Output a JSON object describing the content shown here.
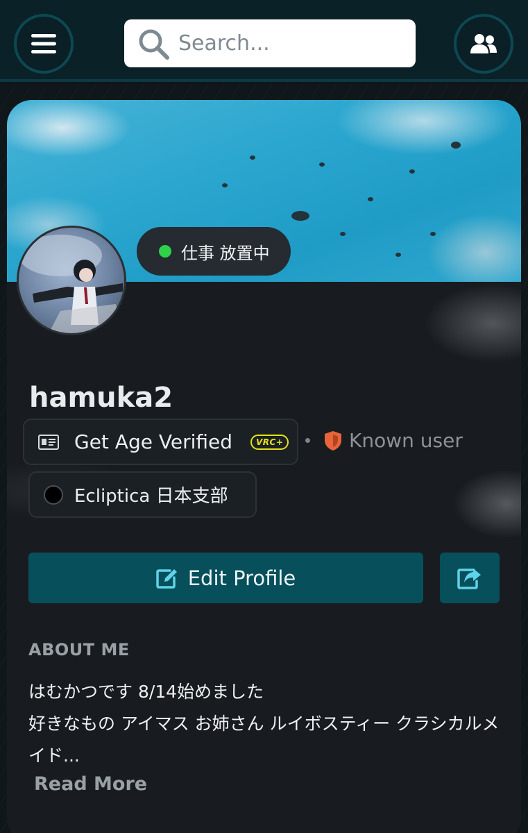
{
  "header": {
    "search_placeholder": "Search...",
    "menu_icon": "hamburger-icon",
    "friends_icon": "users-icon"
  },
  "profile": {
    "status_text": "仕事 放置中",
    "status_color": "#2ed34a",
    "username": "hamuka2",
    "age_verify_label": "Get Age Verified",
    "vrc_badge": "VRC+",
    "trust_label": "Known user",
    "group_name": "Ecliptica 日本支部",
    "edit_label": "Edit Profile"
  },
  "about": {
    "heading": "ABOUT ME",
    "text": "はむかつです 8/14始めました\n好きなもの アイマス お姉さん ルイボスティー クラシカルメイド...",
    "read_more": "Read More"
  },
  "colors": {
    "accent": "#074f5b",
    "trust_shield": "#e8643a",
    "vrc_plus": "#e5e21c"
  }
}
